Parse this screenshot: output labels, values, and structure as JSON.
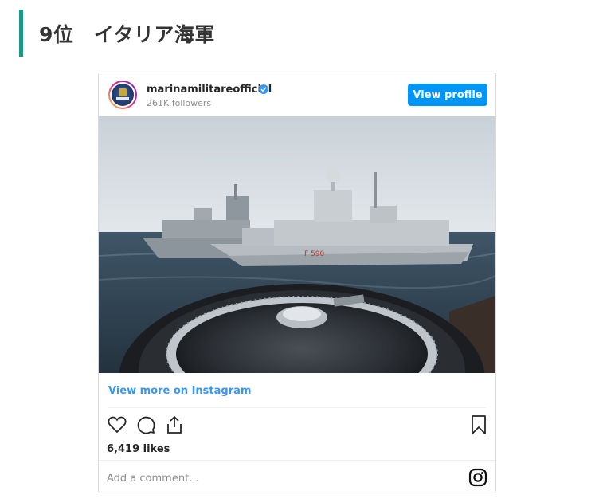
{
  "heading": {
    "text": "9位　イタリア海軍",
    "accent_color": "#1a9a86"
  },
  "embed": {
    "username": "marinamilitareofficial",
    "verified": true,
    "followers": "261K followers",
    "view_profile_label": "View profile",
    "hull_number": "F 590",
    "view_more_label": "View more on Instagram",
    "likes": "6,419 likes",
    "comment_placeholder": "Add a comment...",
    "icons": [
      "heart-icon",
      "comment-icon",
      "share-icon",
      "bookmark-icon",
      "instagram-icon"
    ],
    "accent_color": "#0095f6"
  }
}
